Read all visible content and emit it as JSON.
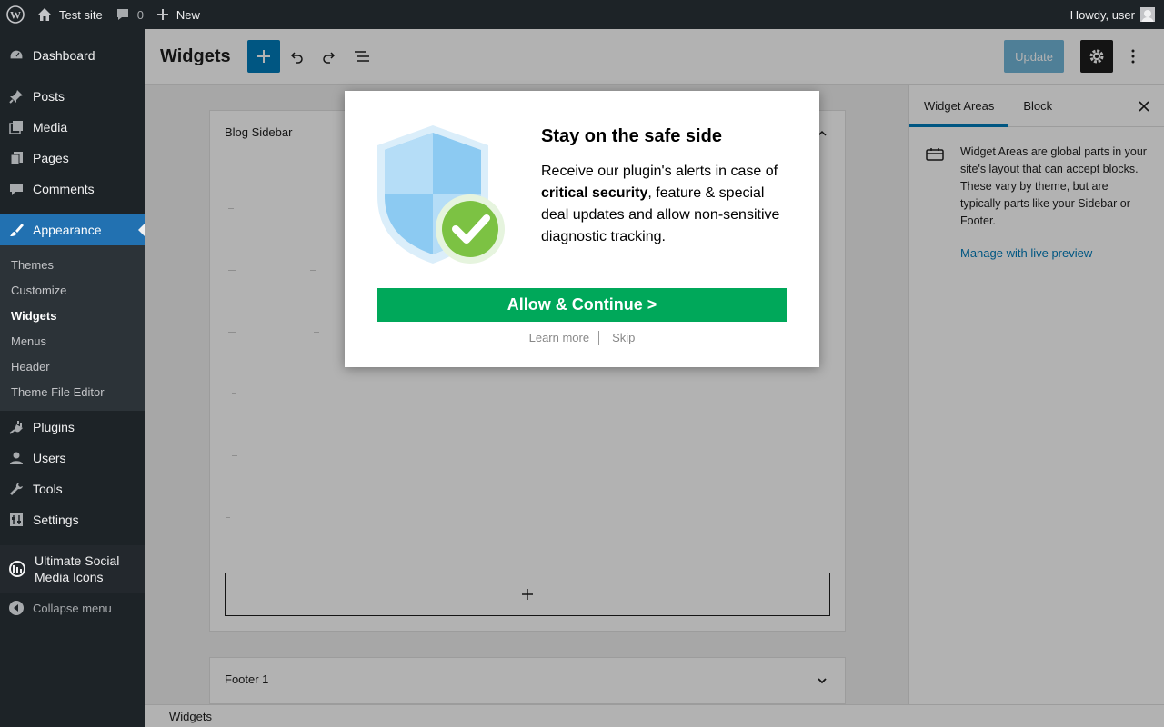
{
  "admin_bar": {
    "site_name": "Test site",
    "comments_count": "0",
    "new_label": "New",
    "greeting": "Howdy, user"
  },
  "sidebar": {
    "items": [
      {
        "label": "Dashboard",
        "icon": "dashboard-icon"
      },
      {
        "label": "Posts",
        "icon": "pin-icon"
      },
      {
        "label": "Media",
        "icon": "media-icon"
      },
      {
        "label": "Pages",
        "icon": "pages-icon"
      },
      {
        "label": "Comments",
        "icon": "comment-icon"
      },
      {
        "label": "Appearance",
        "icon": "brush-icon"
      },
      {
        "label": "Plugins",
        "icon": "plug-icon"
      },
      {
        "label": "Users",
        "icon": "user-icon"
      },
      {
        "label": "Tools",
        "icon": "wrench-icon"
      },
      {
        "label": "Settings",
        "icon": "settings-icon"
      },
      {
        "label": "Ultimate Social Media Icons",
        "icon": "social-icon"
      }
    ],
    "appearance_sub": [
      "Themes",
      "Customize",
      "Widgets",
      "Menus",
      "Header",
      "Theme File Editor"
    ],
    "collapse_label": "Collapse menu"
  },
  "header": {
    "title": "Widgets",
    "update_label": "Update"
  },
  "content": {
    "areas": [
      {
        "title": "Blog Sidebar"
      },
      {
        "title": "Footer 1"
      }
    ]
  },
  "inspector": {
    "tabs": [
      "Widget Areas",
      "Block"
    ],
    "description": "Widget Areas are global parts in your site's layout that can accept blocks. These vary by theme, but are typically parts like your Sidebar or Footer.",
    "link": "Manage with live preview"
  },
  "footer": {
    "breadcrumb": "Widgets"
  },
  "modal": {
    "title": "Stay on the safe side",
    "text_before": "Receive our plugin's alerts in case of ",
    "text_bold": "critical security",
    "text_after": ", feature & special deal updates and allow non-sensitive diagnostic tracking.",
    "primary": "Allow & Continue >",
    "learn_more": "Learn more",
    "skip": "Skip"
  },
  "colors": {
    "admin_dark": "#1d2327",
    "accent": "#2271b1",
    "editor_blue": "#007cba",
    "modal_green": "#00a85a"
  }
}
